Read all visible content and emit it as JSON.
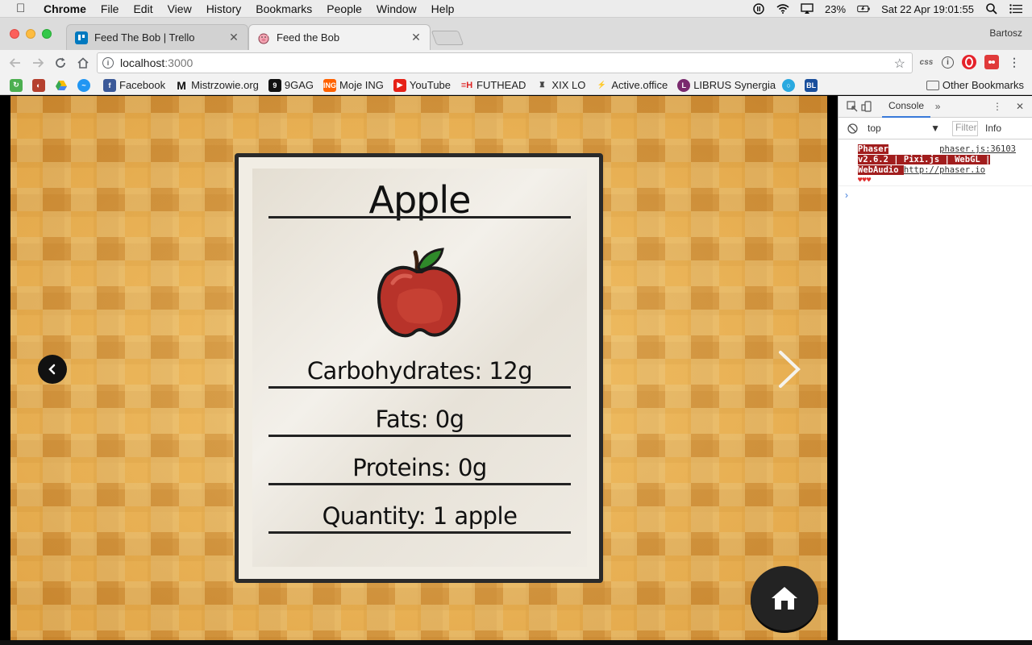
{
  "menubar": {
    "app_name": "Chrome",
    "items": [
      "File",
      "Edit",
      "View",
      "History",
      "Bookmarks",
      "People",
      "Window",
      "Help"
    ],
    "battery": "23%",
    "datetime": "Sat 22 Apr  19:01:55"
  },
  "tabs": [
    {
      "title": "Feed The Bob | Trello",
      "active": false
    },
    {
      "title": "Feed the Bob",
      "active": true
    }
  ],
  "profile_name": "Bartosz",
  "omnibox": {
    "host": "localhost",
    "port": ":3000"
  },
  "extensions": [
    "css",
    "info",
    "opera",
    "red-ext"
  ],
  "bookmarks": [
    {
      "label": "",
      "icon": "green-ext"
    },
    {
      "label": "",
      "icon": "red-ext"
    },
    {
      "label": "",
      "icon": "drive-icon"
    },
    {
      "label": "",
      "icon": "messenger-icon"
    },
    {
      "label": "Facebook",
      "icon": "facebook-icon"
    },
    {
      "label": "Mistrzowie.org",
      "icon": "m-icon"
    },
    {
      "label": "9GAG",
      "icon": "9gag-icon"
    },
    {
      "label": "Moje ING",
      "icon": "ing-icon"
    },
    {
      "label": "YouTube",
      "icon": "youtube-icon"
    },
    {
      "label": "FUTHEAD",
      "icon": "futhead-icon"
    },
    {
      "label": "XIX LO",
      "icon": "school-icon"
    },
    {
      "label": "Active.office",
      "icon": "active-icon"
    },
    {
      "label": "LIBRUS Synergia",
      "icon": "librus-icon"
    },
    {
      "label": "",
      "icon": "circle-icon"
    },
    {
      "label": "",
      "icon": "bl-icon"
    }
  ],
  "other_bookmarks": "Other Bookmarks",
  "game": {
    "card": {
      "title": "Apple",
      "facts": [
        "Carbohydrates: 12g",
        "Fats: 0g",
        "Proteins: 0g",
        "Quantity: 1 apple"
      ]
    }
  },
  "devtools": {
    "tab": "Console",
    "context": "top",
    "filter_placeholder": "Filter",
    "level": "Info",
    "message": {
      "banner_line1": " Phaser ",
      "source": "phaser.js:36103",
      "banner_line2": "v2.6.2 | Pixi.js | WebGL |",
      "banner_line3": "WebAudio ",
      "link": "http://phaser.io",
      "hearts": "♥♥♥"
    },
    "prompt": "›"
  }
}
